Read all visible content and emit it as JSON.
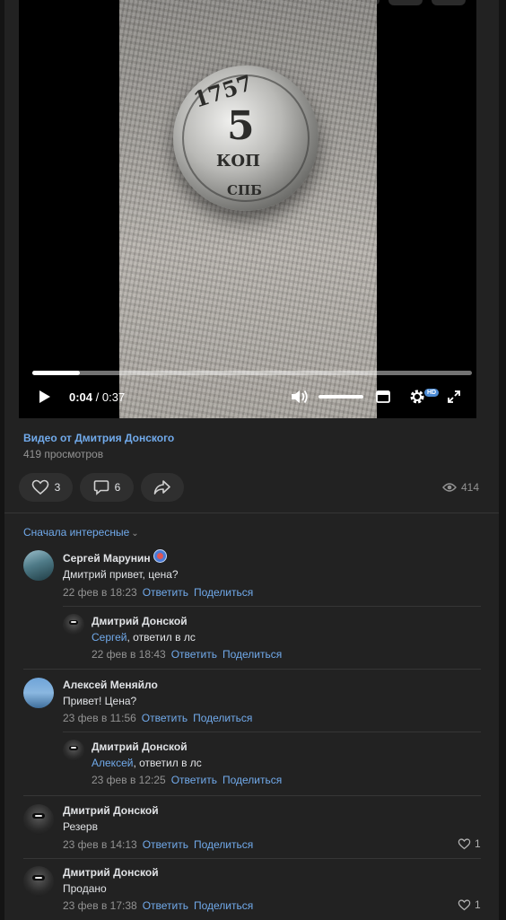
{
  "video": {
    "current_time": "0:04",
    "duration_sep": " / ",
    "duration": "0:37",
    "progress": 0.108,
    "volume": 1.0,
    "quality_badge": "HD",
    "coin": {
      "denomination": "5",
      "unit": "КОП",
      "mint": "СПБ",
      "year": "1757"
    }
  },
  "post": {
    "author_line": "Видео от Дмитрия Донского",
    "views_line": "419 просмотров",
    "likes": "3",
    "comments": "6",
    "view_count": "414"
  },
  "comments": {
    "sort_label": "Сначала интересные",
    "reply_label": "Ответить",
    "share_label": "Поделиться",
    "items": [
      {
        "name": "Сергей Марунин",
        "text": "Дмитрий привет, цена?",
        "meta": "22 фев в 18:23"
      },
      {
        "name": "Дмитрий Донской",
        "mention": "Сергей",
        "text": ", ответил в лс",
        "meta": "22 фев в 18:43"
      },
      {
        "name": "Алексей Меняйло",
        "text": "Привет! Цена?",
        "meta": "23 фев в 11:56"
      },
      {
        "name": "Дмитрий Донской",
        "mention": "Алексей",
        "text": ", ответил в лс",
        "meta": "23 фев в 12:25"
      },
      {
        "name": "Дмитрий Донской",
        "text": "Резерв",
        "meta": "23 фев в 14:13",
        "likes": "1"
      },
      {
        "name": "Дмитрий Донской",
        "text": "Продано",
        "meta": "23 фев в 17:38",
        "likes": "1"
      }
    ]
  },
  "colors": {
    "accent": "#71aaeb",
    "background": "#222222",
    "muted": "#939393"
  }
}
